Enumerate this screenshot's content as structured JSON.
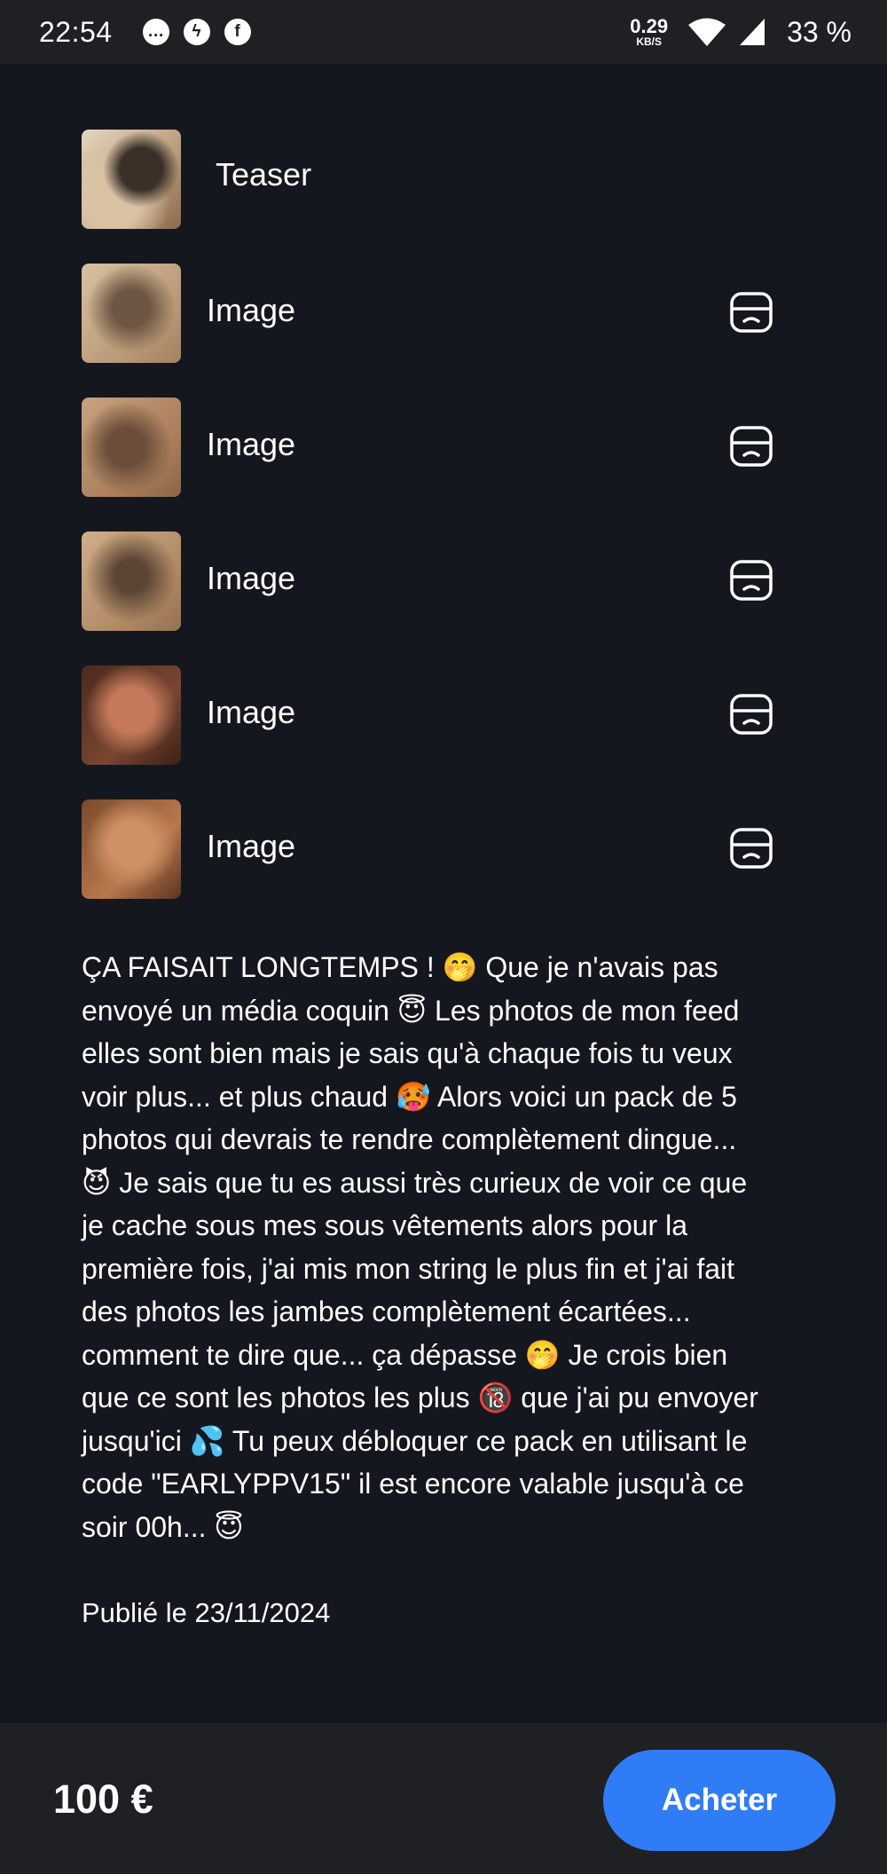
{
  "status_bar": {
    "time": "22:54",
    "network_speed": "0.29",
    "network_unit": "KB/S",
    "battery": "33 %",
    "notification_icons": [
      "message-bubble-icon",
      "messenger-icon",
      "facebook-icon"
    ]
  },
  "media": {
    "teaser_label": "Teaser",
    "items": [
      {
        "label": "Image"
      },
      {
        "label": "Image"
      },
      {
        "label": "Image"
      },
      {
        "label": "Image"
      },
      {
        "label": "Image"
      }
    ]
  },
  "post": {
    "description": "ÇA FAISAIT LONGTEMPS ! 🤭 Que je n'avais pas\nenvoyé un média coquin 😇 Les photos de mon feed\nelles sont bien mais je sais qu'à chaque fois tu veux\nvoir plus... et plus chaud 🥵 Alors voici un pack de 5\nphotos qui devrais te rendre complètement dingue...\n😈 Je sais que tu es aussi très curieux de voir ce que\nje cache sous mes sous vêtements alors pour la\npremière fois, j'ai mis mon string le plus fin et j'ai fait\ndes photos les jambes complètement écartées...\ncomment te dire que... ça dépasse 🤭 Je crois bien\nque ce sont les photos les plus 🔞 que j'ai pu envoyer\njusqu'ici 💦 Tu peux débloquer ce pack en utilisant le\ncode \"EARLYPPV15\" il est encore valable jusqu'à ce\nsoir 00h... 😇",
    "published": "Publié le 23/11/2024"
  },
  "purchase": {
    "price": "100 €",
    "buy_label": "Acheter"
  },
  "colors": {
    "background": "#15171f",
    "bar_background": "#1f2023",
    "accent": "#2f7cf6"
  }
}
